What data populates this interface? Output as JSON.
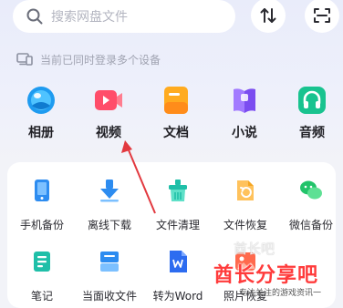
{
  "search": {
    "placeholder": "搜索网盘文件"
  },
  "top_actions": [
    {
      "icon": "transfer-sort-icon"
    },
    {
      "icon": "scan-icon"
    }
  ],
  "devices_notice": {
    "icon": "devices-icon",
    "text": "当前已同时登录多个设备"
  },
  "categories": [
    {
      "label": "相册",
      "icon": "album-icon",
      "color": "#1e9bf0"
    },
    {
      "label": "视频",
      "icon": "video-icon",
      "color": "#ff4d6a"
    },
    {
      "label": "文档",
      "icon": "document-icon",
      "color": "#ffab1f"
    },
    {
      "label": "小说",
      "icon": "novel-icon",
      "color": "#8a5cf6"
    },
    {
      "label": "音频",
      "icon": "audio-icon",
      "color": "#19c38f"
    }
  ],
  "tools": [
    {
      "label": "手机备份",
      "icon": "phone-backup-icon",
      "color": "#2d8cf0"
    },
    {
      "label": "离线下载",
      "icon": "offline-download-icon",
      "color": "#2d8cf0"
    },
    {
      "label": "文件清理",
      "icon": "file-clean-icon",
      "color": "#1fbfa8"
    },
    {
      "label": "文件恢复",
      "icon": "file-restore-icon",
      "color": "#f5a623"
    },
    {
      "label": "微信备份",
      "icon": "wechat-backup-icon",
      "color": "#22c36a"
    },
    {
      "label": "笔记",
      "icon": "notes-icon",
      "color": "#1fbfa8"
    },
    {
      "label": "当面收文件",
      "icon": "receive-file-icon",
      "color": "#2d8cf0"
    },
    {
      "label": "转为Word",
      "icon": "to-word-icon",
      "color": "#2d6cf0"
    },
    {
      "label": "照片恢复",
      "icon": "photo-restore-icon",
      "color": "#ff6a4d"
    }
  ],
  "watermark": {
    "brand": "酋长分享吧",
    "tagline": "专注关注的游戏资讯一",
    "ghost": "酋长吧",
    "brand_color": "#ff3b3b"
  },
  "annotation": {
    "arrow_color": "#e2393f"
  }
}
